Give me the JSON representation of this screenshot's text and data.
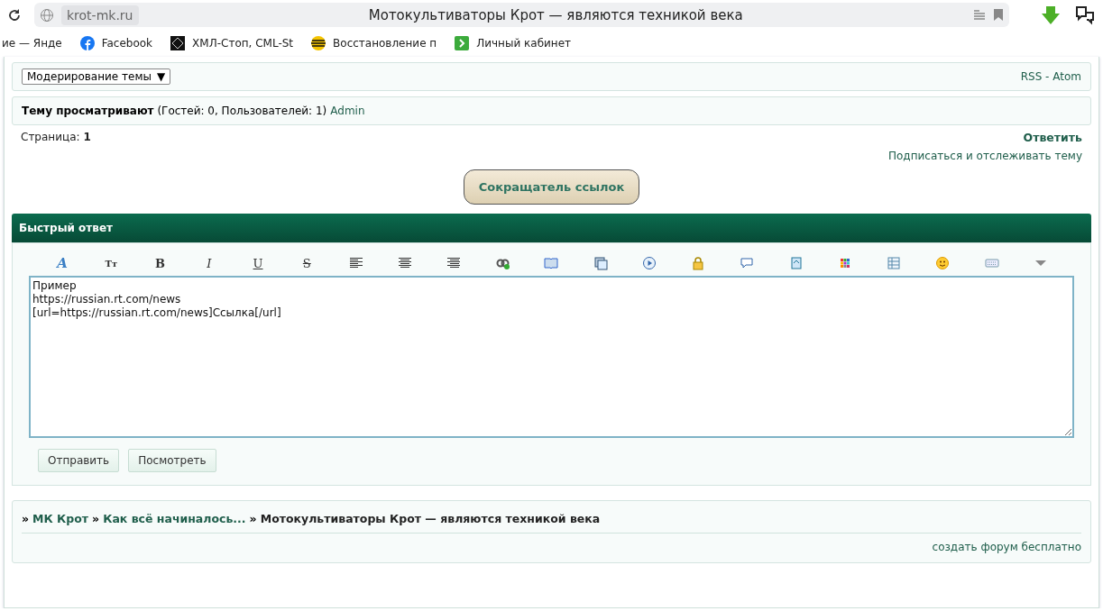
{
  "browser": {
    "domain": "krot-mk.ru",
    "title": "Мотокультиваторы Крот — являются техникой века"
  },
  "bookmarks": [
    {
      "label": "ие — Янде",
      "kind": "text"
    },
    {
      "label": "Facebook",
      "kind": "facebook"
    },
    {
      "label": "ХМЛ-Стоп, CML-St",
      "kind": "diamond"
    },
    {
      "label": "Восстановление п",
      "kind": "stripes"
    },
    {
      "label": "Личный кабинет",
      "kind": "arrow"
    }
  ],
  "moderation": {
    "select": "Модерирование темы",
    "select_arrow": "▼",
    "feed": "RSS - Atom"
  },
  "viewers": {
    "label": "Тему просматривают",
    "counts": "(Гостей: 0, Пользователей: 1)",
    "user": "Admin"
  },
  "pages": {
    "label": "Страница:",
    "current": "1"
  },
  "actions": {
    "reply": "Ответить",
    "subscribe": "Подписаться и отслеживать тему"
  },
  "shortener": "Сокращатель ссылок",
  "quick_reply": {
    "title": "Быстрый ответ",
    "toolbar": [
      {
        "kind": "glyph",
        "text": "A"
      },
      {
        "kind": "glyph",
        "text": "Tт"
      },
      {
        "kind": "glyph",
        "text": "B"
      },
      {
        "kind": "glyph",
        "text": "I"
      },
      {
        "kind": "glyph",
        "text": "U"
      },
      {
        "kind": "glyph",
        "text": "S"
      },
      {
        "kind": "icon"
      },
      {
        "kind": "icon"
      },
      {
        "kind": "icon"
      },
      {
        "kind": "icon"
      },
      {
        "kind": "icon"
      },
      {
        "kind": "icon"
      },
      {
        "kind": "icon"
      },
      {
        "kind": "icon"
      },
      {
        "kind": "icon"
      },
      {
        "kind": "icon"
      },
      {
        "kind": "icon"
      },
      {
        "kind": "icon"
      },
      {
        "kind": "icon"
      },
      {
        "kind": "icon"
      },
      {
        "kind": "icon"
      }
    ],
    "text": "Пример\nhttps://russian.rt.com/news\n[url=https://russian.rt.com/news]Ссылка[/url]",
    "buttons": [
      "Отправить",
      "Посмотреть"
    ]
  },
  "breadcrumb": [
    {
      "sep": "»",
      "text": "МК Крот",
      "kind": "link"
    },
    {
      "sep": "»",
      "text": "Как всё начиналось...",
      "kind": "link"
    },
    {
      "sep": "»",
      "text": "Мотокультиваторы Крот — являются техникой века",
      "kind": "current"
    }
  ],
  "footer_link": "создать форум бесплатно"
}
